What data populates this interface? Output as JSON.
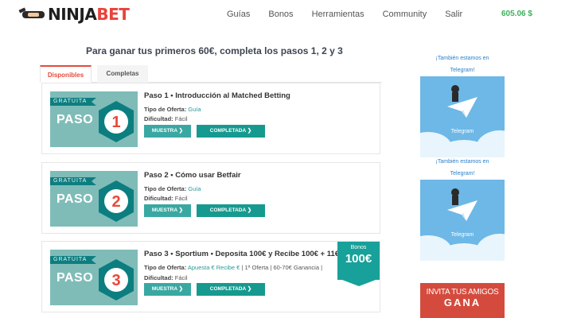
{
  "header": {
    "logo_ninja": "NINJA",
    "logo_bet": "BET",
    "nav": [
      "Guías",
      "Bonos",
      "Herramientas",
      "Community",
      "Salir"
    ],
    "balance": "605.06 $"
  },
  "main": {
    "heading": "Para ganar tus primeros 60€, completa los pasos 1, 2 y 3",
    "tabs": [
      "Disponibles",
      "Completas"
    ],
    "cards": [
      {
        "badge": "GRATUITA",
        "paso_label": "PASO",
        "number": "1",
        "title": "Paso 1 • Introducción al Matched Betting",
        "tipo_label": "Tipo de Oferta:",
        "tipo_value": "Guía",
        "dificultad_label": "Dificultad:",
        "dificultad_value": "Fácil",
        "btn_muestra": "MUESTRA ❯",
        "btn_completada": "COMPLETADA ❯"
      },
      {
        "badge": "GRATUITA",
        "paso_label": "PASO",
        "number": "2",
        "title": "Paso 2 • Cómo usar Betfair",
        "tipo_label": "Tipo de Oferta:",
        "tipo_value": "Guía",
        "dificultad_label": "Dificultad:",
        "dificultad_value": "Fácil",
        "btn_muestra": "MUESTRA ❯",
        "btn_completada": "COMPLETADA ❯"
      },
      {
        "badge": "GRATUITA",
        "paso_label": "PASO",
        "number": "3",
        "title": "Paso 3 • Sportium • Deposita 100€ y Recibe 100€ + 11€",
        "tipo_label": "Tipo de Oferta:",
        "tipo_value": "Apuesta € Recibe €",
        "tipo_extra": " | 1ª Oferta | 60-70€ Ganancia |",
        "dificultad_label": "Dificultad:",
        "dificultad_value": "Fácil",
        "btn_muestra": "MUESTRA ❯",
        "btn_completada": "COMPLETADA ❯",
        "bonus_label": "Bonos",
        "bonus_value": "100€"
      }
    ]
  },
  "sidebar": {
    "telegram_blocks": [
      {
        "text_line1": "¡También estamos en",
        "text_line2": "Telegram!",
        "image_label": "Telegram"
      },
      {
        "text_line1": "¡También estamos en",
        "text_line2": "Telegram!",
        "image_label": "Telegram"
      }
    ],
    "invite_line1": "INVITA TUS AMIGOS",
    "invite_line2": "GANA"
  },
  "colors": {
    "accent_red": "#e74a3b",
    "teal": "#169a8f",
    "balance_green": "#3bb15a",
    "link_blue": "#2a7fc9"
  }
}
